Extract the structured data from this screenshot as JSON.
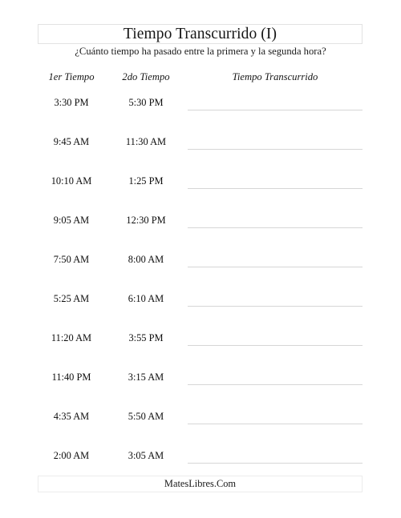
{
  "worksheet": {
    "title": "Tiempo Transcurrido (I)",
    "subtitle": "¿Cuánto tiempo ha pasado entre la primera y la segunda hora?",
    "columns": {
      "first_time": "1er Tiempo",
      "second_time": "2do Tiempo",
      "elapsed_time": "Tiempo Transcurrido"
    },
    "rows": [
      {
        "first_time": "3:30 PM",
        "second_time": "5:30 PM",
        "elapsed_time": ""
      },
      {
        "first_time": "9:45 AM",
        "second_time": "11:30 AM",
        "elapsed_time": ""
      },
      {
        "first_time": "10:10 AM",
        "second_time": "1:25 PM",
        "elapsed_time": ""
      },
      {
        "first_time": "9:05 AM",
        "second_time": "12:30 PM",
        "elapsed_time": ""
      },
      {
        "first_time": "7:50 AM",
        "second_time": "8:00 AM",
        "elapsed_time": ""
      },
      {
        "first_time": "5:25 AM",
        "second_time": "6:10 AM",
        "elapsed_time": ""
      },
      {
        "first_time": "11:20 AM",
        "second_time": "3:55 PM",
        "elapsed_time": ""
      },
      {
        "first_time": "11:40 PM",
        "second_time": "3:15 AM",
        "elapsed_time": ""
      },
      {
        "first_time": "4:35 AM",
        "second_time": "5:50 AM",
        "elapsed_time": ""
      },
      {
        "first_time": "2:00 AM",
        "second_time": "3:05 AM",
        "elapsed_time": ""
      }
    ],
    "footer": "MatesLibres.Com"
  },
  "colors": {
    "page_background": "#ffffff",
    "text": "#000000",
    "box_border": "#e2e2e2",
    "answer_line": "#d6d6d6"
  }
}
